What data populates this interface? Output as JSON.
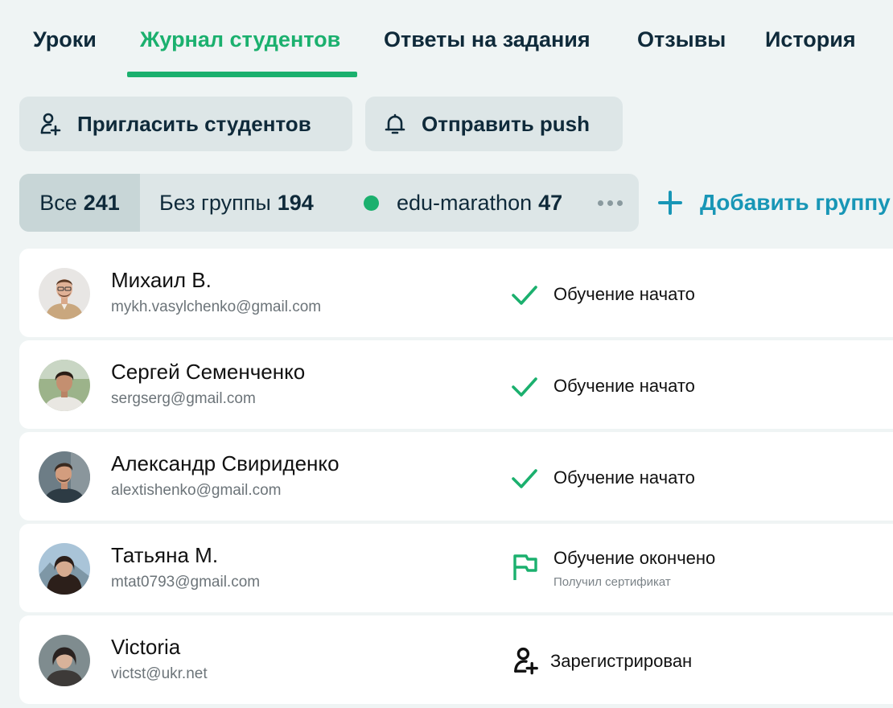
{
  "tabs": [
    {
      "label": "Уроки",
      "active": false
    },
    {
      "label": "Журнал студентов",
      "active": true
    },
    {
      "label": "Ответы на задания",
      "active": false
    },
    {
      "label": "Отзывы",
      "active": false
    },
    {
      "label": "История",
      "active": false
    }
  ],
  "actions": {
    "invite_label": "Пригласить студентов",
    "invite_icon": "user-plus-icon",
    "push_label": "Отправить push",
    "push_icon": "bell-icon"
  },
  "filters": {
    "all": {
      "label": "Все",
      "count": "241"
    },
    "no_group": {
      "label": "Без группы",
      "count": "194"
    },
    "group": {
      "label": "edu-marathon",
      "count": "47",
      "color": "#1bb06e"
    },
    "more_icon": "more-dots-icon",
    "add_group_label": "Добавить группу",
    "add_group_icon": "plus-icon"
  },
  "colors": {
    "accent_green": "#1bb06e",
    "link_blue": "#1896b6",
    "text_dark": "#0f2a3a",
    "background": "#eff4f4",
    "button_bg": "#dde6e7"
  },
  "students": [
    {
      "name": "Михаил В.",
      "email": "mykh.vasylchenko@gmail.com",
      "status": "Обучение начато",
      "status_icon": "check-icon",
      "sub": ""
    },
    {
      "name": "Сергей Семенченко",
      "email": "sergserg@gmail.com",
      "status": "Обучение начато",
      "status_icon": "check-icon",
      "sub": ""
    },
    {
      "name": "Александр Свириденко",
      "email": "alextishenko@gmail.com",
      "status": "Обучение начато",
      "status_icon": "check-icon",
      "sub": ""
    },
    {
      "name": "Татьяна М.",
      "email": "mtat0793@gmail.com",
      "status": "Обучение окончено",
      "status_icon": "flag-icon",
      "sub": "Получил сертификат"
    },
    {
      "name": "Victoria",
      "email": "victst@ukr.net",
      "status": "Зарегистрирован",
      "status_icon": "user-plus-icon",
      "sub": ""
    }
  ]
}
